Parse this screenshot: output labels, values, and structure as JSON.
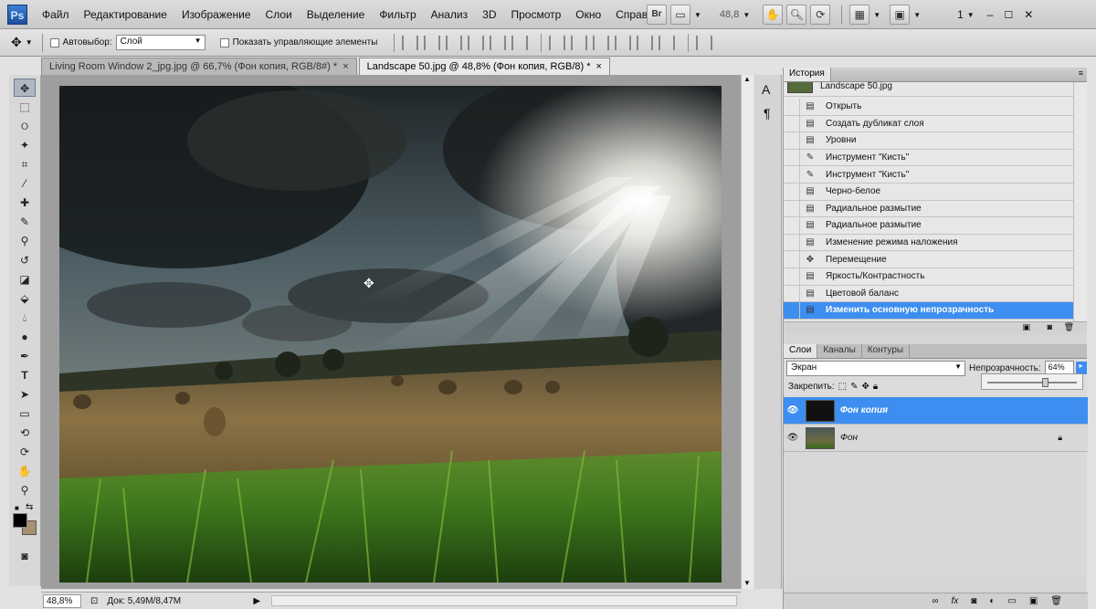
{
  "menubar": {
    "logo": "Ps",
    "items": [
      "Файл",
      "Редактирование",
      "Изображение",
      "Слои",
      "Выделение",
      "Фильтр",
      "Анализ",
      "3D",
      "Просмотр",
      "Окно",
      "Справка"
    ],
    "br_label": "Br",
    "zoom_value": "48,8",
    "workspace_count": "1"
  },
  "options": {
    "autoselect_label": "Автовыбор:",
    "autoselect_value": "Слой",
    "show_controls_label": "Показать управляющие элементы"
  },
  "tabs": [
    {
      "label": "Living Room Window 2_jpg.jpg @ 66,7% (Фон копия, RGB/8#) *",
      "close": "×"
    },
    {
      "label": "Landscape 50.jpg @ 48,8% (Фон копия, RGB/8) *",
      "close": "×"
    }
  ],
  "status": {
    "zoom": "48,8%",
    "doc": "Док: 5,49M/8,47M"
  },
  "history": {
    "tab": "История",
    "snapshot": "Landscape 50.jpg",
    "items": [
      "Открыть",
      "Создать дубликат слоя",
      "Уровни",
      "Инструмент \"Кисть\"",
      "Инструмент \"Кисть\"",
      "Черно-белое",
      "Радиальное размытие",
      "Радиальное размытие",
      "Изменение режима наложения",
      "Перемещение",
      "Яркость/Контрастность",
      "Цветовой баланс",
      "Изменить основную непрозрачность"
    ]
  },
  "layers": {
    "tabs": [
      "Слои",
      "Каналы",
      "Контуры"
    ],
    "blend_mode": "Экран",
    "opacity_label": "Непрозрачность:",
    "opacity_value": "64%",
    "opacity_fraction": 0.64,
    "lock_label": "Закрепить:",
    "items": [
      "Фон копия",
      "Фон"
    ]
  }
}
